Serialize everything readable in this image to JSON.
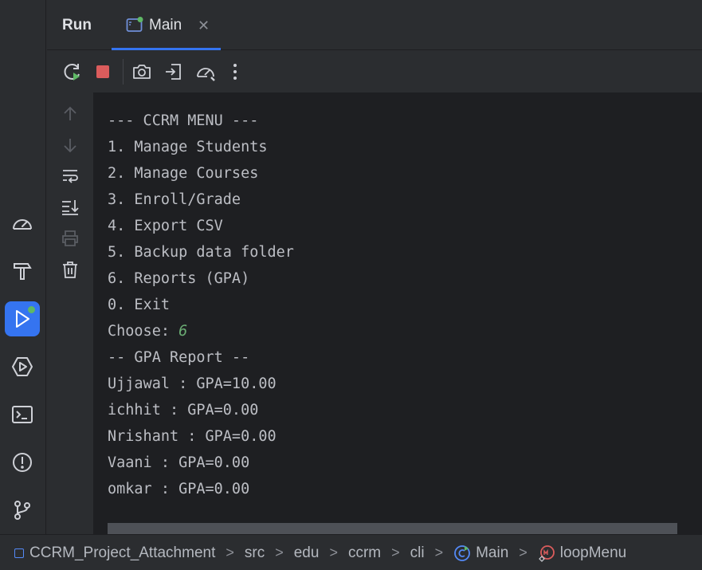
{
  "tool_window": {
    "title": "Run",
    "tab": {
      "label": "Main",
      "close_glyph": "✕",
      "icon": "app-window-icon",
      "running": true
    }
  },
  "toolbar": {
    "buttons": [
      "rerun-icon",
      "stop-icon",
      "camera-icon",
      "exit-icon",
      "speedometer-icon",
      "more-vert-icon"
    ]
  },
  "activity_bar": {
    "items": [
      "profiler-icon",
      "build-hammer-icon",
      "run-icon",
      "services-icon",
      "terminal-icon",
      "problems-icon",
      "git-icon"
    ],
    "active": "run-icon"
  },
  "gutter": {
    "items": [
      "arrow-up-icon",
      "arrow-down-icon",
      "soft-wrap-icon",
      "scroll-to-end-icon",
      "print-icon",
      "trash-icon"
    ]
  },
  "console": {
    "lines": [
      "--- CCRM MENU ---",
      "1. Manage Students",
      "2. Manage Courses",
      "3. Enroll/Grade",
      "4. Export CSV",
      "5. Backup data folder",
      "6. Reports (GPA)",
      "0. Exit"
    ],
    "prompt": "Choose: ",
    "input": "6",
    "output": [
      "-- GPA Report --",
      "Ujjawal : GPA=10.00",
      "ichhit : GPA=0.00",
      "Nrishant : GPA=0.00",
      "Vaani : GPA=0.00",
      "omkar : GPA=0.00"
    ]
  },
  "breadcrumb": {
    "items": [
      "CCRM_Project_Attachment",
      "src",
      "edu",
      "ccrm",
      "cli",
      "Main",
      "loopMenu"
    ],
    "separator": ">"
  },
  "colors": {
    "accent": "#3574f0",
    "run_dot": "#5fb865",
    "input_text": "#6aab73",
    "console_bg": "#1e1f22",
    "panel_bg": "#2b2d30"
  }
}
